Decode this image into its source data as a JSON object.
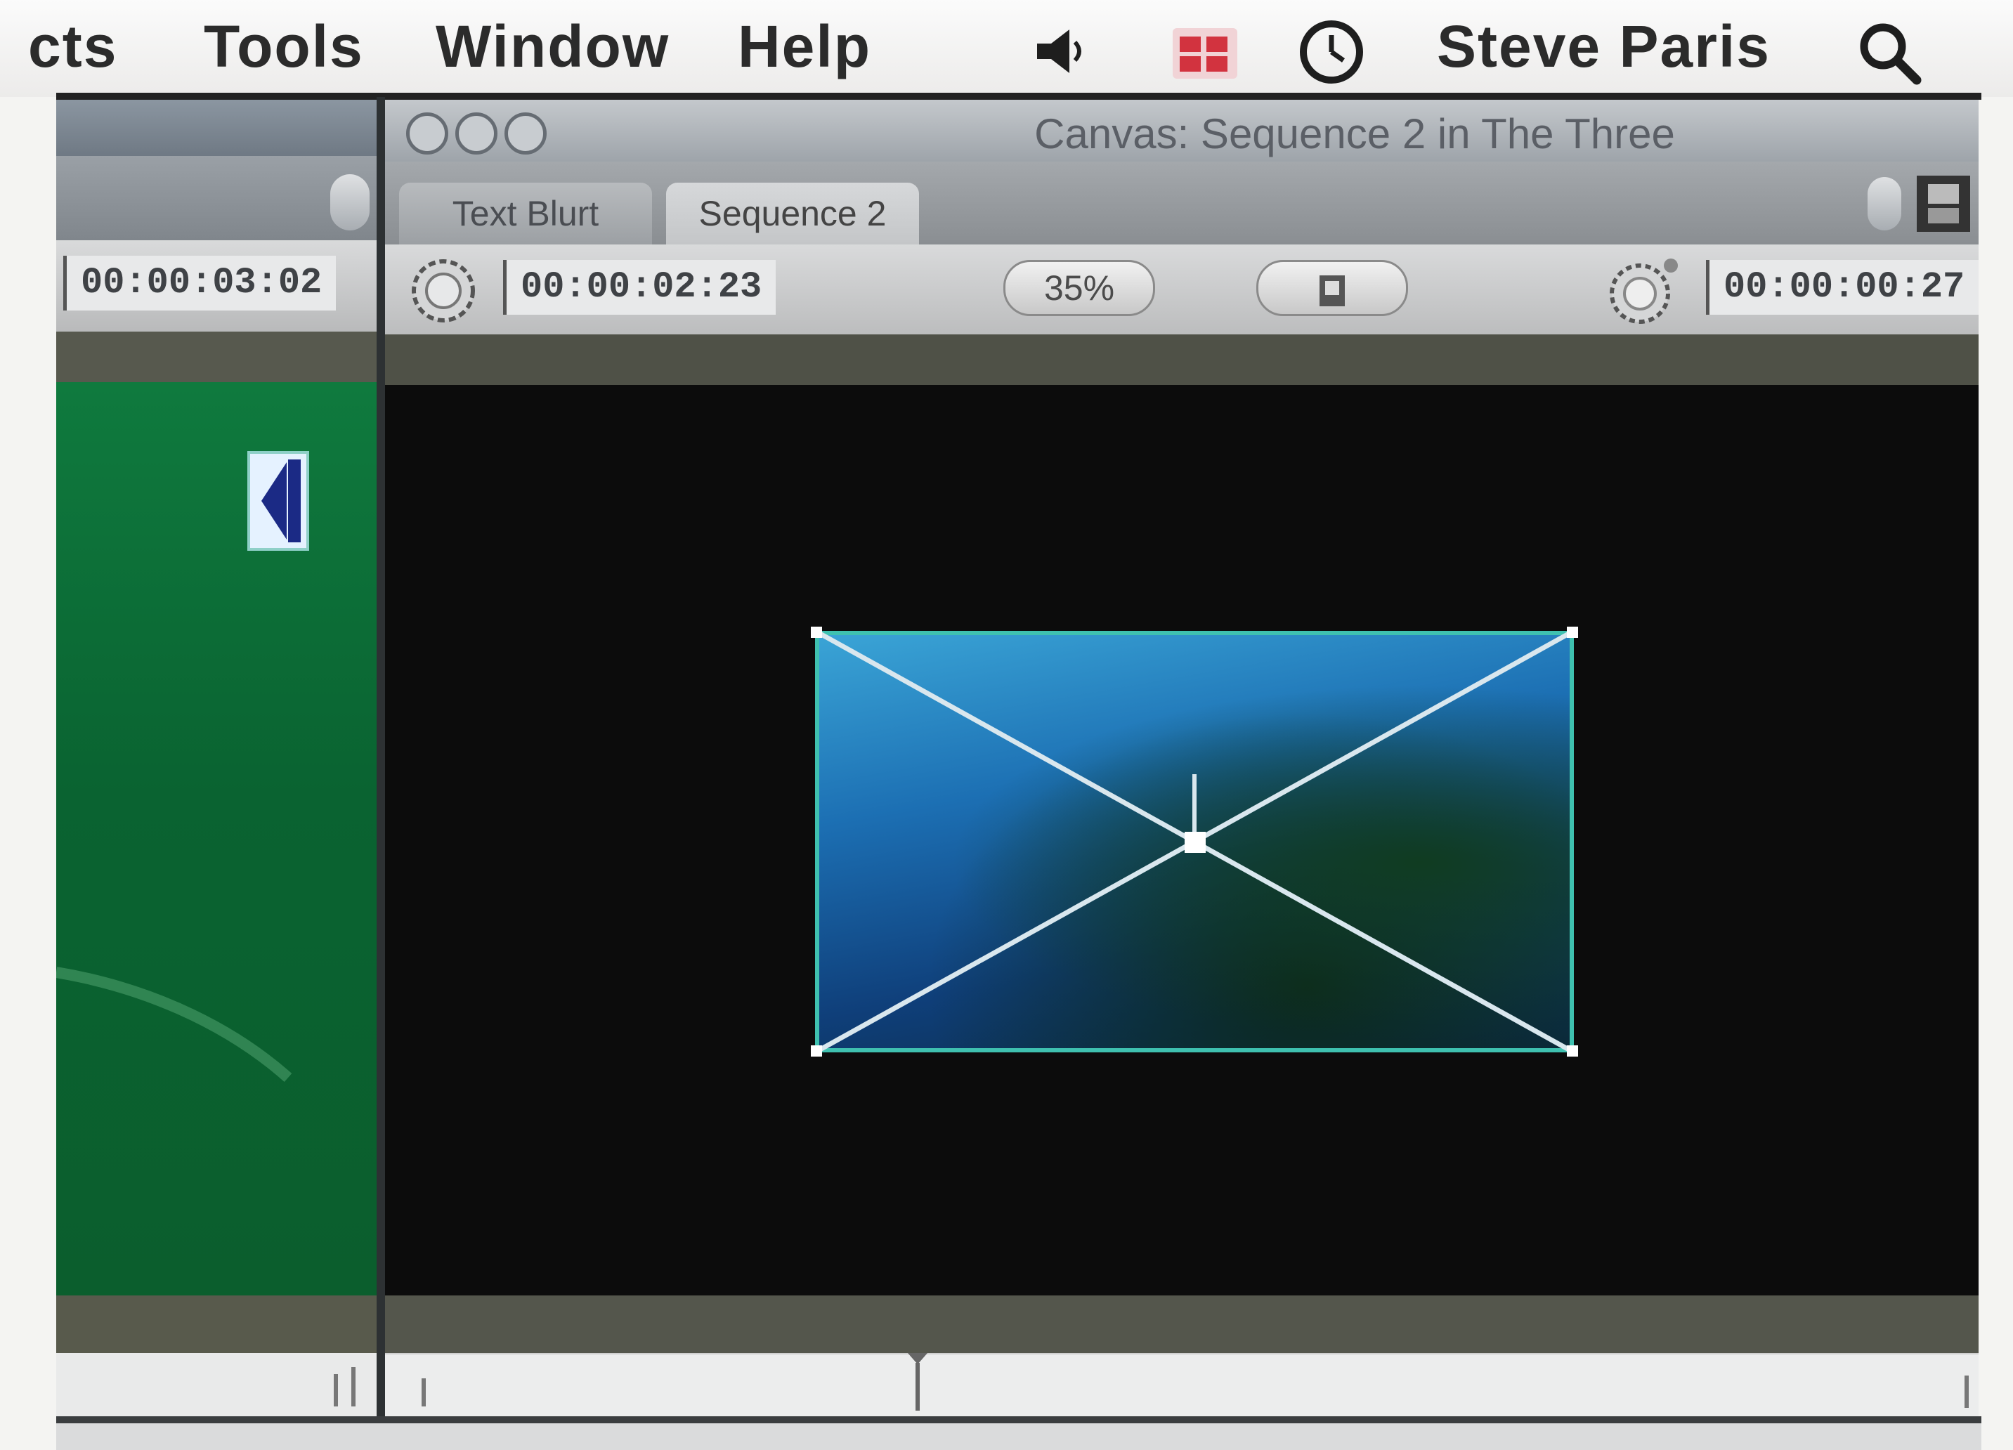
{
  "menubar": {
    "items": [
      "cts",
      "Tools",
      "Window",
      "Help"
    ],
    "user_name": "Steve Paris",
    "icons": [
      "volume-icon",
      "input-menu-icon",
      "clock-icon",
      "spotlight-search-icon"
    ]
  },
  "viewer": {
    "timecode": "00:00:03:02"
  },
  "canvas": {
    "title": "Canvas: Sequence 2 in The Three",
    "tabs": [
      "Text Blurt",
      "Sequence 2"
    ],
    "active_tab": "Sequence 2",
    "current_timecode": "00:00:02:23",
    "zoom": "35%",
    "view_mode_icon": "view-mode-icon",
    "duration_timecode": "00:00:00:27"
  },
  "colors": {
    "wireframe": "#3fc1b0",
    "viewer_green": "#0b6a35",
    "canvas_background": "#0c0c0c"
  }
}
